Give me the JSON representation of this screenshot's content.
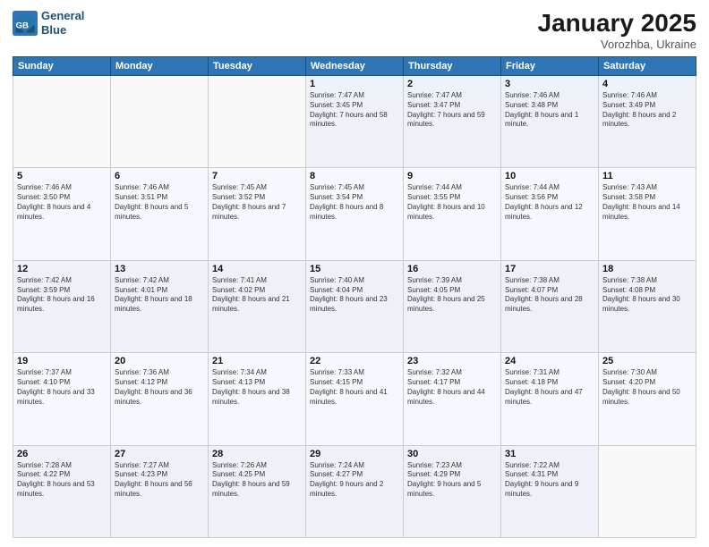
{
  "logo": {
    "line1": "General",
    "line2": "Blue"
  },
  "header": {
    "month": "January 2025",
    "location": "Vorozhba, Ukraine"
  },
  "weekdays": [
    "Sunday",
    "Monday",
    "Tuesday",
    "Wednesday",
    "Thursday",
    "Friday",
    "Saturday"
  ],
  "weeks": [
    [
      {
        "day": "",
        "text": ""
      },
      {
        "day": "",
        "text": ""
      },
      {
        "day": "",
        "text": ""
      },
      {
        "day": "1",
        "text": "Sunrise: 7:47 AM\nSunset: 3:45 PM\nDaylight: 7 hours and 58 minutes."
      },
      {
        "day": "2",
        "text": "Sunrise: 7:47 AM\nSunset: 3:47 PM\nDaylight: 7 hours and 59 minutes."
      },
      {
        "day": "3",
        "text": "Sunrise: 7:46 AM\nSunset: 3:48 PM\nDaylight: 8 hours and 1 minute."
      },
      {
        "day": "4",
        "text": "Sunrise: 7:46 AM\nSunset: 3:49 PM\nDaylight: 8 hours and 2 minutes."
      }
    ],
    [
      {
        "day": "5",
        "text": "Sunrise: 7:46 AM\nSunset: 3:50 PM\nDaylight: 8 hours and 4 minutes."
      },
      {
        "day": "6",
        "text": "Sunrise: 7:46 AM\nSunset: 3:51 PM\nDaylight: 8 hours and 5 minutes."
      },
      {
        "day": "7",
        "text": "Sunrise: 7:45 AM\nSunset: 3:52 PM\nDaylight: 8 hours and 7 minutes."
      },
      {
        "day": "8",
        "text": "Sunrise: 7:45 AM\nSunset: 3:54 PM\nDaylight: 8 hours and 8 minutes."
      },
      {
        "day": "9",
        "text": "Sunrise: 7:44 AM\nSunset: 3:55 PM\nDaylight: 8 hours and 10 minutes."
      },
      {
        "day": "10",
        "text": "Sunrise: 7:44 AM\nSunset: 3:56 PM\nDaylight: 8 hours and 12 minutes."
      },
      {
        "day": "11",
        "text": "Sunrise: 7:43 AM\nSunset: 3:58 PM\nDaylight: 8 hours and 14 minutes."
      }
    ],
    [
      {
        "day": "12",
        "text": "Sunrise: 7:42 AM\nSunset: 3:59 PM\nDaylight: 8 hours and 16 minutes."
      },
      {
        "day": "13",
        "text": "Sunrise: 7:42 AM\nSunset: 4:01 PM\nDaylight: 8 hours and 18 minutes."
      },
      {
        "day": "14",
        "text": "Sunrise: 7:41 AM\nSunset: 4:02 PM\nDaylight: 8 hours and 21 minutes."
      },
      {
        "day": "15",
        "text": "Sunrise: 7:40 AM\nSunset: 4:04 PM\nDaylight: 8 hours and 23 minutes."
      },
      {
        "day": "16",
        "text": "Sunrise: 7:39 AM\nSunset: 4:05 PM\nDaylight: 8 hours and 25 minutes."
      },
      {
        "day": "17",
        "text": "Sunrise: 7:38 AM\nSunset: 4:07 PM\nDaylight: 8 hours and 28 minutes."
      },
      {
        "day": "18",
        "text": "Sunrise: 7:38 AM\nSunset: 4:08 PM\nDaylight: 8 hours and 30 minutes."
      }
    ],
    [
      {
        "day": "19",
        "text": "Sunrise: 7:37 AM\nSunset: 4:10 PM\nDaylight: 8 hours and 33 minutes."
      },
      {
        "day": "20",
        "text": "Sunrise: 7:36 AM\nSunset: 4:12 PM\nDaylight: 8 hours and 36 minutes."
      },
      {
        "day": "21",
        "text": "Sunrise: 7:34 AM\nSunset: 4:13 PM\nDaylight: 8 hours and 38 minutes."
      },
      {
        "day": "22",
        "text": "Sunrise: 7:33 AM\nSunset: 4:15 PM\nDaylight: 8 hours and 41 minutes."
      },
      {
        "day": "23",
        "text": "Sunrise: 7:32 AM\nSunset: 4:17 PM\nDaylight: 8 hours and 44 minutes."
      },
      {
        "day": "24",
        "text": "Sunrise: 7:31 AM\nSunset: 4:18 PM\nDaylight: 8 hours and 47 minutes."
      },
      {
        "day": "25",
        "text": "Sunrise: 7:30 AM\nSunset: 4:20 PM\nDaylight: 8 hours and 50 minutes."
      }
    ],
    [
      {
        "day": "26",
        "text": "Sunrise: 7:28 AM\nSunset: 4:22 PM\nDaylight: 8 hours and 53 minutes."
      },
      {
        "day": "27",
        "text": "Sunrise: 7:27 AM\nSunset: 4:23 PM\nDaylight: 8 hours and 56 minutes."
      },
      {
        "day": "28",
        "text": "Sunrise: 7:26 AM\nSunset: 4:25 PM\nDaylight: 8 hours and 59 minutes."
      },
      {
        "day": "29",
        "text": "Sunrise: 7:24 AM\nSunset: 4:27 PM\nDaylight: 9 hours and 2 minutes."
      },
      {
        "day": "30",
        "text": "Sunrise: 7:23 AM\nSunset: 4:29 PM\nDaylight: 9 hours and 5 minutes."
      },
      {
        "day": "31",
        "text": "Sunrise: 7:22 AM\nSunset: 4:31 PM\nDaylight: 9 hours and 9 minutes."
      },
      {
        "day": "",
        "text": ""
      }
    ]
  ]
}
